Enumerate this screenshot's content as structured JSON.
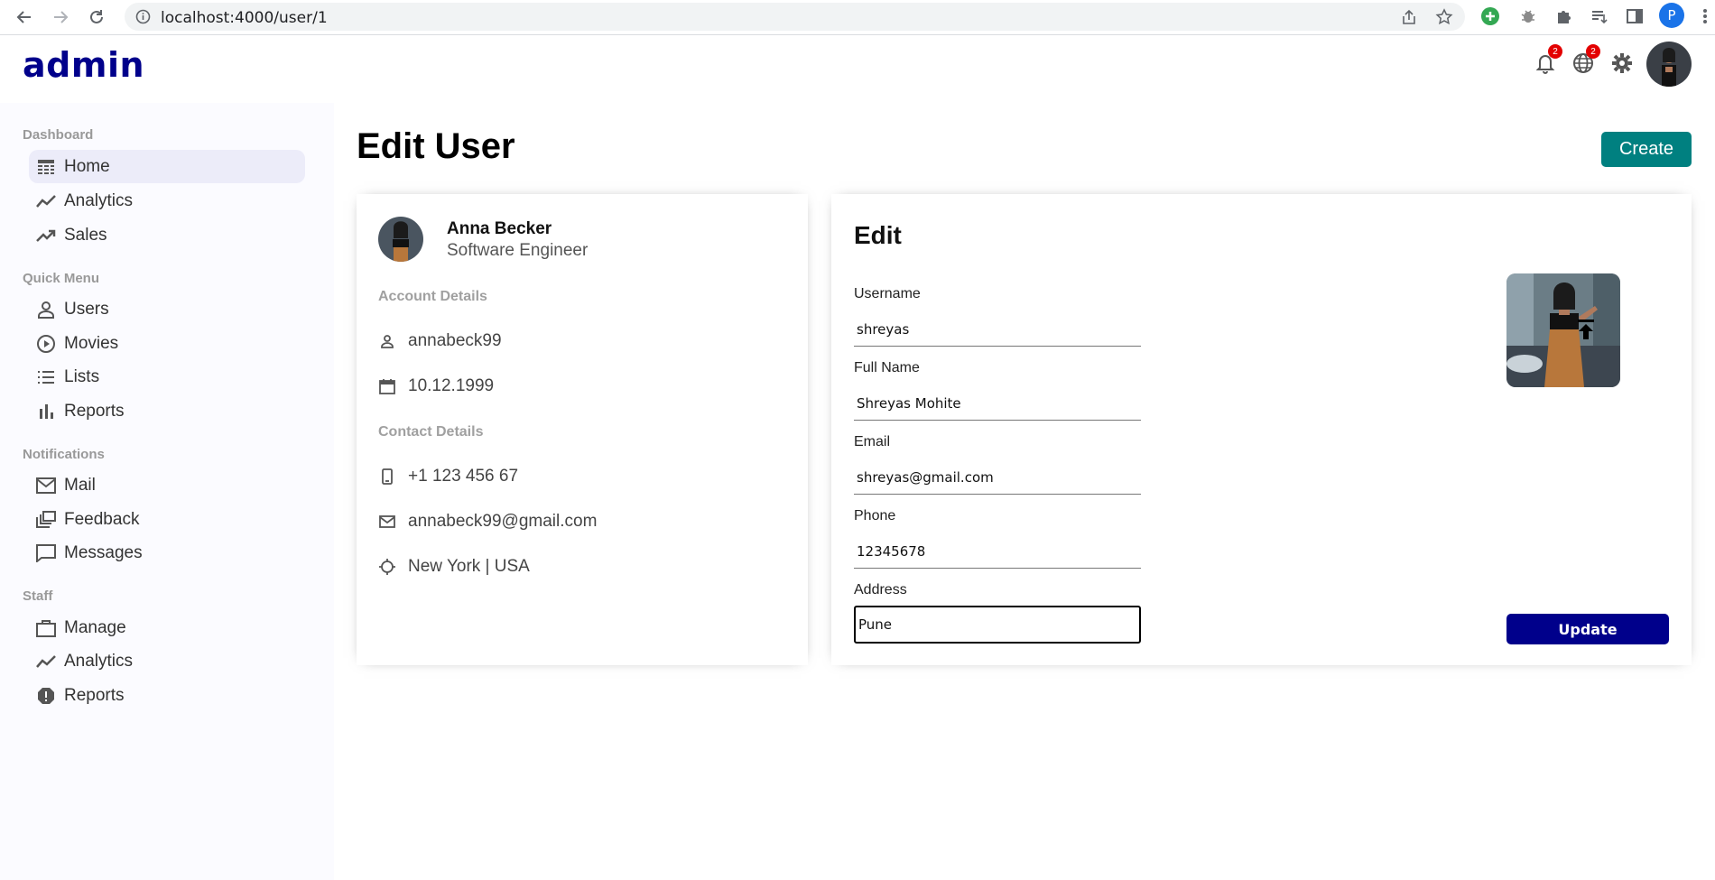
{
  "browser": {
    "url": "localhost:4000/user/1",
    "profile_initial": "P"
  },
  "topbar": {
    "logo": "admin",
    "notifications_badge": "2",
    "language_badge": "2"
  },
  "sidebar": {
    "sections": [
      {
        "title": "Dashboard",
        "items": [
          {
            "label": "Home",
            "icon": "home-icon"
          },
          {
            "label": "Analytics",
            "icon": "timeline-icon"
          },
          {
            "label": "Sales",
            "icon": "trending-up-icon"
          }
        ]
      },
      {
        "title": "Quick Menu",
        "items": [
          {
            "label": "Users",
            "icon": "person-icon"
          },
          {
            "label": "Movies",
            "icon": "play-circle-icon"
          },
          {
            "label": "Lists",
            "icon": "list-icon"
          },
          {
            "label": "Reports",
            "icon": "bar-chart-icon"
          }
        ]
      },
      {
        "title": "Notifications",
        "items": [
          {
            "label": "Mail",
            "icon": "mail-icon"
          },
          {
            "label": "Feedback",
            "icon": "dynamic-feed-icon"
          },
          {
            "label": "Messages",
            "icon": "chat-bubble-icon"
          }
        ]
      },
      {
        "title": "Staff",
        "items": [
          {
            "label": "Manage",
            "icon": "work-icon"
          },
          {
            "label": "Analytics",
            "icon": "timeline-icon"
          },
          {
            "label": "Reports",
            "icon": "report-icon"
          }
        ]
      }
    ]
  },
  "page": {
    "title": "Edit User",
    "create_label": "Create"
  },
  "user_show": {
    "name": "Anna Becker",
    "role": "Software Engineer",
    "account_title": "Account Details",
    "username": "annabeck99",
    "birthday": "10.12.1999",
    "contact_title": "Contact Details",
    "phone": "+1 123 456 67",
    "email": "annabeck99@gmail.com",
    "location": "New York | USA"
  },
  "user_edit": {
    "title": "Edit",
    "fields": [
      {
        "label": "Username",
        "value": "shreyas"
      },
      {
        "label": "Full Name",
        "value": "Shreyas Mohite"
      },
      {
        "label": "Email",
        "value": "shreyas@gmail.com"
      },
      {
        "label": "Phone",
        "value": "12345678"
      },
      {
        "label": "Address",
        "value": "Pune"
      }
    ],
    "update_label": "Update"
  }
}
